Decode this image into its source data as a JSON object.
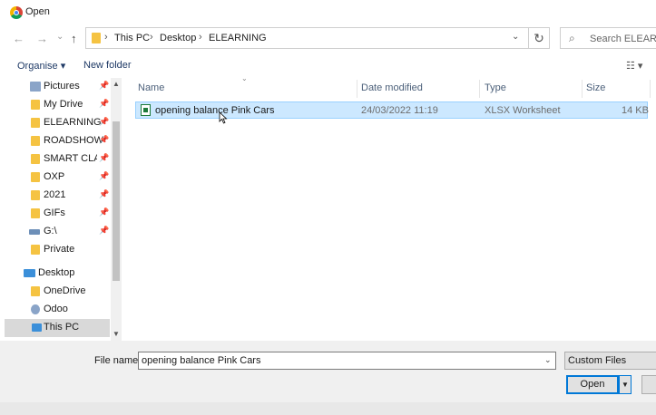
{
  "window": {
    "title": "Open"
  },
  "nav": {
    "back": "←",
    "forward": "→",
    "recent": "⌄",
    "up": "↑",
    "breadcrumbs": [
      "This PC",
      "Desktop",
      "ELEARNING"
    ],
    "separator": "›",
    "search_placeholder": "Search ELEARNING"
  },
  "toolbar": {
    "organise": "Organise ▾",
    "new_folder": "New folder",
    "view": "☷ ▾"
  },
  "sidebar": {
    "items": [
      {
        "label": "Pictures",
        "pinned": true
      },
      {
        "label": "My Drive",
        "pinned": true
      },
      {
        "label": "ELEARNING",
        "pinned": true
      },
      {
        "label": "ROADSHOW",
        "pinned": true
      },
      {
        "label": "SMART CLASS",
        "pinned": true
      },
      {
        "label": "OXP",
        "pinned": true
      },
      {
        "label": "2021",
        "pinned": true
      },
      {
        "label": "GIFs",
        "pinned": true
      },
      {
        "label": "G:\\",
        "pinned": true
      },
      {
        "label": "Private",
        "pinned": false
      },
      {
        "label": "Desktop",
        "pinned": false
      },
      {
        "label": "OneDrive",
        "pinned": false
      },
      {
        "label": "Odoo",
        "pinned": false
      },
      {
        "label": "This PC",
        "pinned": false
      }
    ],
    "pin_glyph": "📌"
  },
  "columns": {
    "name": "Name",
    "date": "Date modified",
    "type": "Type",
    "size": "Size"
  },
  "files": [
    {
      "name": "opening balance Pink Cars",
      "date": "24/03/2022 11:19",
      "type": "XLSX Worksheet",
      "size": "14 KB"
    }
  ],
  "footer": {
    "filename_label": "File name:",
    "filename_value": "opening balance Pink Cars",
    "filter_value": "Custom Files",
    "open_label": "Open",
    "open_dropdown": "▼"
  },
  "colors": {
    "selection_bg": "#cce8ff",
    "accent": "#0078d7",
    "folder": "#f5c342"
  }
}
